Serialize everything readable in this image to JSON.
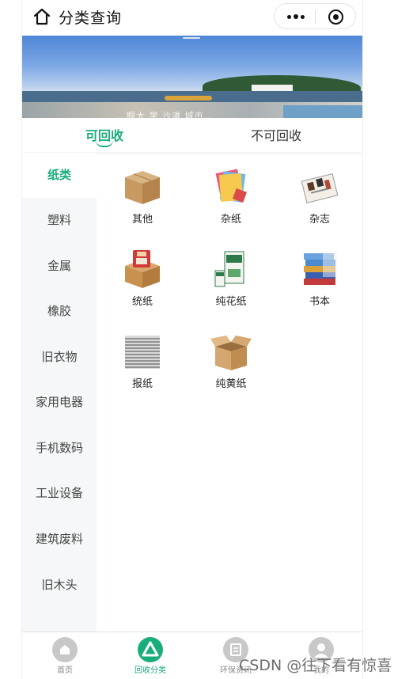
{
  "header": {
    "title": "分类查询"
  },
  "banner": {
    "caption": "…眼大 学 沙滩 城市…"
  },
  "tabs": [
    {
      "label": "可回收",
      "active": true
    },
    {
      "label": "不可回收",
      "active": false
    }
  ],
  "sidebar": {
    "items": [
      {
        "label": "纸类",
        "active": true
      },
      {
        "label": "塑料"
      },
      {
        "label": "金属"
      },
      {
        "label": "橡胶"
      },
      {
        "label": "旧衣物"
      },
      {
        "label": "家用电器"
      },
      {
        "label": "手机数码"
      },
      {
        "label": "工业设备"
      },
      {
        "label": "建筑废料"
      },
      {
        "label": "旧木头"
      }
    ]
  },
  "grid": {
    "items": [
      {
        "label": "其他",
        "icon": "cardboard-box-icon"
      },
      {
        "label": "杂纸",
        "icon": "colored-paper-icon"
      },
      {
        "label": "杂志",
        "icon": "magazine-icon"
      },
      {
        "label": "统纸",
        "icon": "gift-box-icon"
      },
      {
        "label": "纯花纸",
        "icon": "tissue-box-icon"
      },
      {
        "label": "书本",
        "icon": "book-stack-icon"
      },
      {
        "label": "报纸",
        "icon": "newspaper-stack-icon"
      },
      {
        "label": "纯黄纸",
        "icon": "open-box-icon"
      }
    ]
  },
  "tabbar": {
    "items": [
      {
        "label": "首页",
        "icon": "home-icon"
      },
      {
        "label": "回收分类",
        "icon": "recycle-icon",
        "active": true
      },
      {
        "label": "环保资讯",
        "icon": "news-icon"
      },
      {
        "label": "我的",
        "icon": "user-icon"
      }
    ]
  },
  "watermark": "CSDN @往下看有惊喜",
  "colors": {
    "accent": "#1aad7c",
    "sidebar_bg": "#f6f7f8"
  }
}
